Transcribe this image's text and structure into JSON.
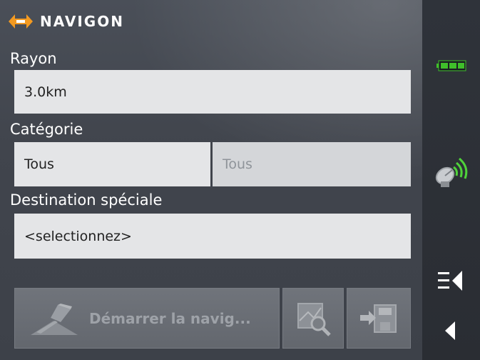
{
  "app": {
    "logo_text": "NAVIGON"
  },
  "form": {
    "radius": {
      "label": "Rayon",
      "value": "3.0km"
    },
    "category": {
      "label": "Catégorie",
      "value": "Tous",
      "sub_value": "Tous"
    },
    "poi": {
      "label": "Destination spéciale",
      "value": "<selectionnez>"
    }
  },
  "actions": {
    "start_navigation": "Démarrer la navig...",
    "show_on_map_icon": "map-search-icon",
    "save_icon": "save-destination-icon"
  },
  "sidebar": {
    "battery_icon": "battery-icon",
    "gps_icon": "gps-satellite-icon",
    "menu_icon": "menu-icon",
    "back_icon": "back-arrow-icon"
  },
  "colors": {
    "brand_orange": "#f39a21",
    "battery_green": "#3fbf2a",
    "gps_green": "#4fd23a"
  }
}
